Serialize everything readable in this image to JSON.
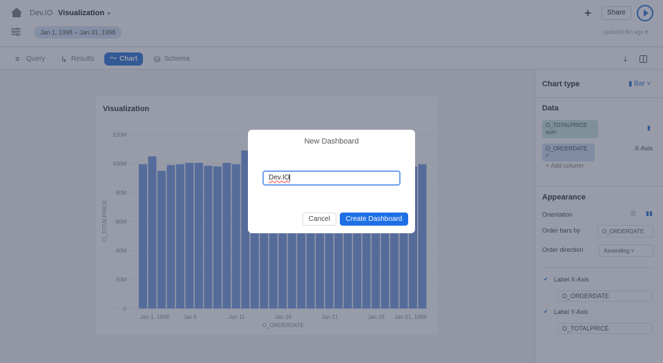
{
  "header": {
    "breadcrumb": "Dev.IO",
    "title": "Visualization",
    "date_range": "Jan 1, 1998 – Jan 31, 1998",
    "share": "Share",
    "updated": "Updated 6m ago ▾"
  },
  "tabs": [
    {
      "label": "Query"
    },
    {
      "label": "Results"
    },
    {
      "label": "Chart"
    },
    {
      "label": "Schema"
    }
  ],
  "sidebar": {
    "chart_type_label": "Chart type",
    "chart_type_value": "Bar",
    "data_heading": "Data",
    "measure": "O_TOTALPRICE",
    "measure_agg": "sum",
    "dimension": "O_ORDERDATE",
    "x_axis": "X-Axis",
    "add_column": "Add column",
    "appearance": "Appearance",
    "orientation": "Orientation",
    "order_by_label": "Order bars by",
    "order_by_value": "O_ORDERDATE",
    "order_dir_label": "Order direction",
    "order_dir_value": "Ascending",
    "label_x": "Label X-Axis",
    "label_x_value": "O_ORDERDATE",
    "label_y": "Label Y-Axis",
    "label_y_value": "O_TOTALPRICE"
  },
  "chart_data": {
    "type": "bar",
    "title": "Visualization",
    "xlabel": "O_ORDERDATE",
    "ylabel": "O_TOTALPRICE",
    "ylim": [
      0,
      120000000
    ],
    "yticks": [
      "0",
      "20M",
      "40M",
      "60M",
      "80M",
      "100M",
      "120M"
    ],
    "xticks": [
      {
        "label": "Jan 1, 1998",
        "i": 0
      },
      {
        "label": "Jan 6",
        "i": 5
      },
      {
        "label": "Jan 11",
        "i": 10
      },
      {
        "label": "Jan 16",
        "i": 15
      },
      {
        "label": "Jan 21",
        "i": 20
      },
      {
        "label": "Jan 26",
        "i": 25
      },
      {
        "label": "Jan 31, 1998",
        "i": 30
      }
    ],
    "values": [
      99.5,
      105,
      95,
      99,
      99.5,
      100.5,
      100.5,
      98.5,
      98,
      100.5,
      99.5,
      109,
      100,
      100,
      100,
      100,
      100,
      100,
      100,
      100,
      100,
      100,
      100,
      100,
      100,
      100,
      100,
      100,
      100,
      98,
      99.5
    ],
    "unit": "M",
    "bar_color": "#7fa3e6"
  },
  "modal": {
    "title": "New Dashboard",
    "input_value": "Dev.IO",
    "cancel": "Cancel",
    "create": "Create Dashboard"
  }
}
